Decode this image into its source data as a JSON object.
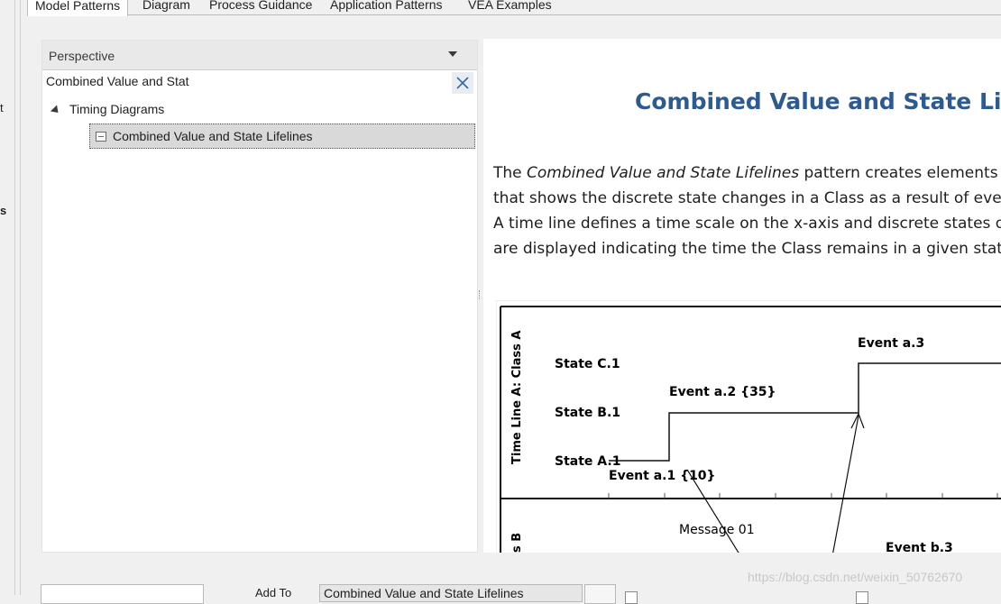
{
  "gutter": {
    "glyph1": "t",
    "glyph2": "s"
  },
  "tabs": [
    {
      "label": "Model Patterns",
      "active": true
    },
    {
      "label": "Diagram",
      "active": false
    },
    {
      "label": "Process Guidance",
      "active": false
    },
    {
      "label": "Application Patterns",
      "active": false
    },
    {
      "label": "VEA Examples",
      "active": false
    }
  ],
  "left_panel": {
    "perspective_label": "Perspective",
    "search_value": "Combined Value and Stat",
    "tree": {
      "root_label": "Timing Diagrams",
      "child_label": "Combined Value and State Lifelines"
    }
  },
  "doc": {
    "title": "Combined Value and State Lifelin",
    "para_prefix": "The ",
    "para_italic": "Combined Value and State Lifelines",
    "para_line1_rest": " pattern creates elements an",
    "para_line2": "that shows the discrete state changes in a Class as a result of event",
    "para_line3": "A time line defines a time scale on the x-axis and discrete states on",
    "para_line4": "are displayed indicating the time the Class remains in a given state."
  },
  "diagram": {
    "lifeline_a_label": "Time Line A: Class A",
    "lifeline_b_label": "s B",
    "states": [
      "State C.1",
      "State B.1",
      "State A.1"
    ],
    "events": [
      "Event a.1 {10}",
      "Event a.2 {35}",
      "Event a.3",
      "Event b.3"
    ],
    "message": "Message 01"
  },
  "bottom": {
    "add_to_label": "Add To",
    "combo_value": "Combined Value and State Lifelines"
  },
  "watermark": "https://blog.csdn.net/weixin_50762670",
  "colors": {
    "title": "#2e5a8c",
    "selection": "#d9d9d9",
    "panel_header": "#e9e9e9"
  }
}
